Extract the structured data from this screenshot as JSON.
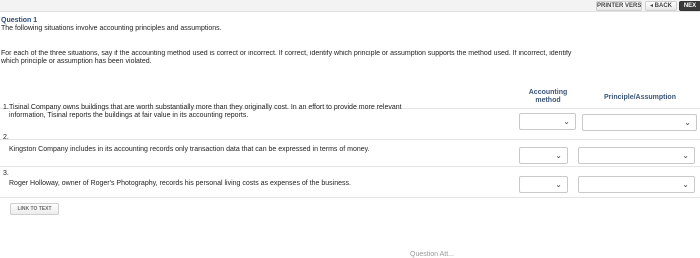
{
  "toolbar": {
    "printer_label": "PRINTER VERSION",
    "back_label": "◂ BACK",
    "next_label": "NEX"
  },
  "question": {
    "title": "Question 1",
    "subtitle": "The following situations involve accounting principles and assumptions.",
    "intro": "For each of the three situations, say if the accounting method used is correct or incorrect. If correct, identify which principle or assumption supports the method used. If incorrect, identify",
    "intro_line2": "which principle or assumption has been violated."
  },
  "table": {
    "headers": {
      "accounting_method_line1": "Accounting",
      "accounting_method_line2": "method",
      "principle": "Principle/Assumption"
    },
    "rows": [
      {
        "num": "1.",
        "line1": "Tisinal Company owns buildings that are worth substantially more than they originally cost. In an effort to provide more relevant",
        "line2": "information, Tisinal reports the buildings at fair value in its accounting reports.",
        "method_value": "",
        "principle_value": ""
      },
      {
        "num": "2.",
        "line1": "Kingston Company includes in its accounting records only transaction data that can be expressed in terms of money.",
        "line2": "",
        "method_value": "",
        "principle_value": ""
      },
      {
        "num": "3.",
        "line1": "Roger Holloway, owner of Roger's Photography, records his personal living costs as expenses of the business.",
        "line2": "",
        "method_value": "",
        "principle_value": ""
      }
    ]
  },
  "link_to_text_label": "LINK TO TEXT",
  "footer_nav_label": "Question Att...",
  "icons": {
    "dropdown": "chevron-down-icon"
  }
}
